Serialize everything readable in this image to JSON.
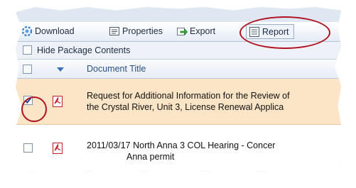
{
  "toolbar": {
    "download_label": "Download",
    "properties_label": "Properties",
    "export_label": "Export",
    "report_label": "Report"
  },
  "hide_package": {
    "label": "Hide Package Contents",
    "checked": false
  },
  "table": {
    "column_header": "Document Title",
    "rows": [
      {
        "checked": true,
        "selected": true,
        "line1": "Request for Additional Information for the Review of",
        "line2": "the Crystal River, Unit 3, License Renewal Applica"
      },
      {
        "checked": false,
        "selected": false,
        "line1": "2011/03/17 North Anna 3 COL Hearing - Concer",
        "line2": "Anna permit"
      }
    ]
  },
  "colors": {
    "selected_row": "#fbe5c6",
    "highlight_ring": "#b0121e",
    "pdf_red": "#c8202a",
    "header_text": "#2a4f86"
  },
  "icons": [
    "download-icon",
    "properties-icon",
    "export-icon",
    "report-icon",
    "sort-arrow-icon",
    "pdf-icon",
    "checkmark-icon"
  ]
}
